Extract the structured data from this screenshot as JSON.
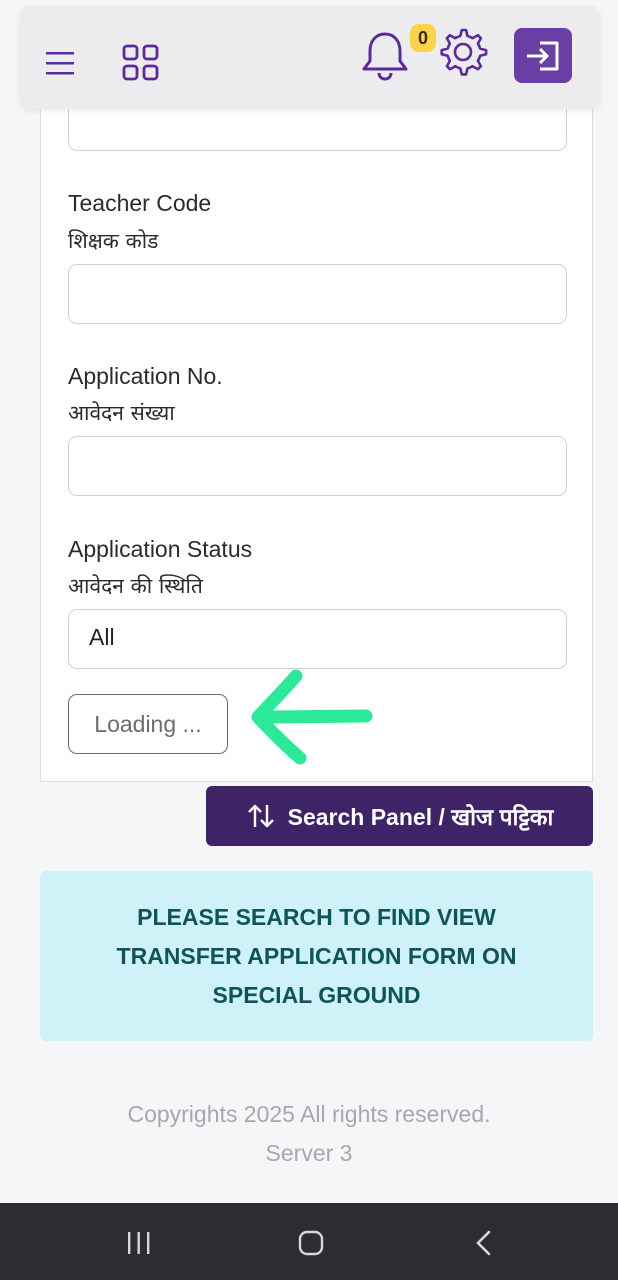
{
  "navbar": {
    "menu_icon": "hamburger-menu-icon",
    "apps_icon": "grid-apps-icon",
    "notification_icon": "bell-icon",
    "notification_count": "0",
    "settings_icon": "gear-icon",
    "logout_icon": "sign-in-arrow-icon",
    "accent_color": "#6a3fa3"
  },
  "form": {
    "teacher_code": {
      "label_en": "Teacher Code",
      "label_hi": "शिक्षक कोड",
      "value": ""
    },
    "application_no": {
      "label_en": "Application No.",
      "label_hi": "आवेदन संख्या",
      "value": ""
    },
    "application_status": {
      "label_en": "Application Status",
      "label_hi": "आवेदन की स्थिति",
      "selected": "All"
    },
    "submit_label": "Loading ..."
  },
  "search_panel_toggle": {
    "icon": "swap-vertical-arrows-icon",
    "label": "Search Panel / खोज पट्टिका",
    "color": "#3f2367"
  },
  "alert": {
    "message": "PLEASE SEARCH TO FIND VIEW TRANSFER APPLICATION FORM ON SPECIAL GROUND",
    "background": "#cff1f8"
  },
  "footer": {
    "copyright": "Copyrights 2025 All rights reserved.",
    "server": "Server 3"
  },
  "annotation": {
    "icon": "hand-drawn-arrow-icon",
    "color": "#2ee89a"
  },
  "system_nav": {
    "recents_icon": "recents-icon",
    "home_icon": "home-icon",
    "back_icon": "back-icon"
  }
}
